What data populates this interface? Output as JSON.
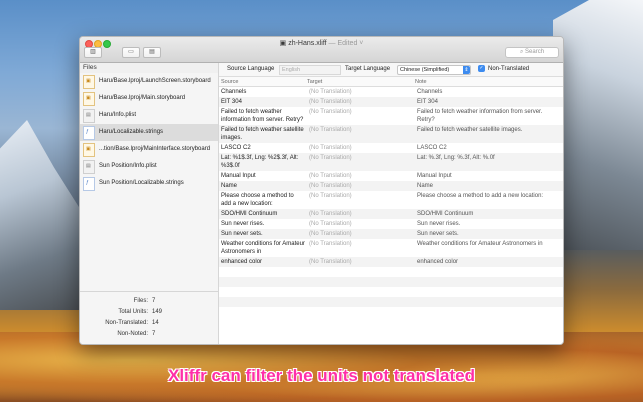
{
  "window": {
    "file_name": "zh-Hans.xliff",
    "status": "— Edited ˅"
  },
  "toolbar": {
    "search_placeholder": "Search",
    "btn_sidebar_icon": "sidebar-icon",
    "btn_folder_icon": "folder-icon",
    "btn_save_icon": "save-icon"
  },
  "sidebar": {
    "header": "Files",
    "files": [
      {
        "name": "Haru/Base.lproj/LaunchScreen.storyboard",
        "type": "storyboard"
      },
      {
        "name": "Haru/Base.lproj/Main.storyboard",
        "type": "storyboard"
      },
      {
        "name": "Haru/Info.plist",
        "type": "plist"
      },
      {
        "name": "Haru/Localizable.strings",
        "type": "strings"
      },
      {
        "name": "...tion/Base.lproj/MainInterface.storyboard",
        "type": "storyboard"
      },
      {
        "name": "Sun Position/Info.plist",
        "type": "plist"
      },
      {
        "name": "Sun Position/Localizable.strings",
        "type": "strings"
      }
    ],
    "stats": [
      {
        "label": "Files:",
        "value": "7"
      },
      {
        "label": "Total Units:",
        "value": "149"
      },
      {
        "label": "Non-Translated:",
        "value": "14"
      },
      {
        "label": "Non-Noted:",
        "value": "7"
      }
    ]
  },
  "lang_bar": {
    "source_label": "Source Language",
    "source_value": "English",
    "target_label": "Target Language",
    "target_value": "Chinese (Simplified)",
    "filter_label": "Non-Translated"
  },
  "columns": {
    "source": "Source",
    "target": "Target",
    "note": "Note"
  },
  "units": [
    {
      "source": "Channels",
      "target": "(No Translation)",
      "note": "Channels"
    },
    {
      "source": "EIT 304",
      "target": "(No Translation)",
      "note": "EIT 304"
    },
    {
      "source": "Failed to fetch weather information from server. Retry?",
      "target": "(No Translation)",
      "note": "Failed to fetch weather information from server. Retry?"
    },
    {
      "source": "Failed to fetch weather satellite images.",
      "target": "(No Translation)",
      "note": "Failed to fetch weather satellite images."
    },
    {
      "source": "LASCO C2",
      "target": "(No Translation)",
      "note": "LASCO C2"
    },
    {
      "source": "Lat: %1$.3f, Lng: %2$.3f, Alt: %3$.0f",
      "target": "(No Translation)",
      "note": "Lat: %.3f, Lng: %.3f, Alt: %.0f"
    },
    {
      "source": "Manual Input",
      "target": "(No Translation)",
      "note": "Manual Input"
    },
    {
      "source": "Name",
      "target": "(No Translation)",
      "note": "Name"
    },
    {
      "source": "Please choose a method to add a new location:",
      "target": "(No Translation)",
      "note": "Please choose a method to add a new location:"
    },
    {
      "source": "SDO/HMI Continuum",
      "target": "(No Translation)",
      "note": "SDO/HMI Continuum"
    },
    {
      "source": "Sun never rises.",
      "target": "(No Translation)",
      "note": "Sun never rises."
    },
    {
      "source": "Sun never sets.",
      "target": "(No Translation)",
      "note": "Sun never sets."
    },
    {
      "source": "Weather conditions for Amateur Astronomers in",
      "target": "(No Translation)",
      "note": "Weather conditions for Amateur Astronomers in"
    },
    {
      "source": "enhanced color",
      "target": "(No Translation)",
      "note": "enhanced color"
    }
  ],
  "caption": "Xliffr can filter the units  not translated"
}
